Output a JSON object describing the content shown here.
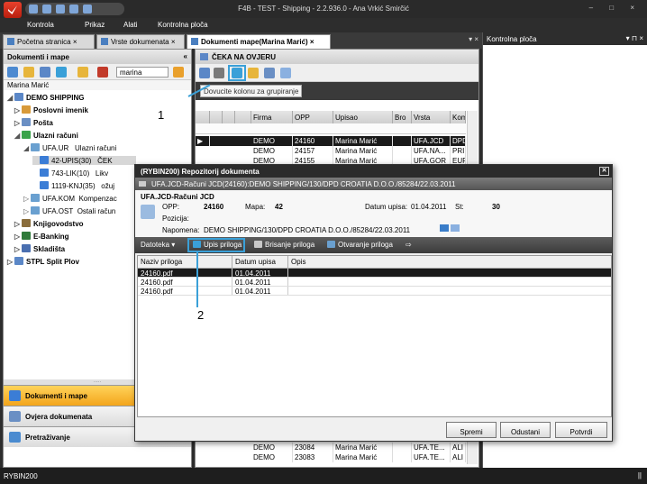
{
  "app": {
    "title": "F4B - TEST - Shipping - 2.2.936.0 - Ana  Vrkić Smirčić",
    "window_controls": "– □ ×"
  },
  "menu": [
    "Kontrola",
    "Prikaz",
    "Alati",
    "Kontrolna ploča"
  ],
  "tabs": [
    {
      "label": "Početna stranica",
      "active": false
    },
    {
      "label": "Vrste dokumenata",
      "active": false
    },
    {
      "label": "Dokumenti mape(Marina Marić)",
      "active": true
    }
  ],
  "tab_controls": "▾ ×",
  "right_panel": {
    "title": "Kontrolna ploča",
    "controls": "▾ ⊓ ×"
  },
  "left_panel": {
    "title": "Dokumenti i mape",
    "collapse": "«",
    "search_value": "marina",
    "user": "Marina Marić",
    "tree": [
      {
        "label": "DEMO SHIPPING",
        "bold": true
      },
      {
        "label": "Poslovni imenik",
        "bold": true
      },
      {
        "label": "Pošta",
        "bold": true
      },
      {
        "label": "Ulazni računi",
        "bold": true
      },
      {
        "label": "UFA.UR",
        "desc": "Ulazni računi"
      },
      {
        "label": "42-UPIS(30)",
        "desc": "ČEK"
      },
      {
        "label": "743-LIK(10)",
        "desc": "Likv"
      },
      {
        "label": "1119-KNJ(35)",
        "desc": "ožuj"
      },
      {
        "label": "UFA.KOM",
        "desc": "Kompenzac"
      },
      {
        "label": "UFA.OST",
        "desc": "Ostali račun"
      },
      {
        "label": "Knjigovodstvo",
        "bold": true
      },
      {
        "label": "E-Banking",
        "bold": true
      },
      {
        "label": "Skladišta",
        "bold": true
      },
      {
        "label": "STPL Split Plov",
        "bold": true
      }
    ],
    "nav": [
      {
        "label": "Dokumenti i mape",
        "active": true
      },
      {
        "label": "Ovjera dokumenata",
        "active": false
      },
      {
        "label": "Pretraživanje",
        "active": false
      }
    ]
  },
  "main": {
    "title": "ČEKA NA OVJERU",
    "group_hint": "Dovucite kolonu za grupiranje",
    "columns": [
      "Firma",
      "OPP",
      "Upisao",
      "Bro",
      "Vrsta",
      "Kom"
    ],
    "rows": [
      [
        "DEMO",
        "24160",
        "Marina Marić",
        "",
        "UFA.JCD",
        "DPD"
      ],
      [
        "DEMO",
        "24157",
        "Marina Marić",
        "",
        "UFA.NA...",
        "PRI"
      ],
      [
        "DEMO",
        "24155",
        "Marina Marić",
        "",
        "UFA.GOR",
        "EUR"
      ]
    ],
    "bottom_rows": [
      [
        "DEMO",
        "23084",
        "Marina Marić",
        "",
        "UFA.TE...",
        "ALI"
      ],
      [
        "DEMO",
        "23083",
        "Marina Marić",
        "",
        "UFA.TE...",
        "ALI"
      ]
    ]
  },
  "dialog": {
    "title": "(RYBIN200) Repozitorij dokumenta",
    "subtitle": "UFA.JCD-Računi JCD(24160):DEMO SHIPPING/130/DPD CROATIA D.O.O./85284/22.03.2011",
    "doc_name": "UFA.JCD-Računi JCD",
    "opp_label": "OPP:",
    "opp": "24160",
    "mapa_label": "Mapa:",
    "mapa": "42",
    "datum_label": "Datum upisa:",
    "datum": "01.04.2011",
    "st_label": "St:",
    "st": "30",
    "pozicija_label": "Pozicija:",
    "napomena_label": "Napomena:",
    "napomena": "DEMO SHIPPING/130/DPD CROATIA D.O.O./85284/22.03.2011",
    "toolbar": {
      "datoteka": "Datoteka ▾",
      "upis": "Upis priloga",
      "brisanje": "Brisanje priloga",
      "otvaranje": "Otvaranje priloga"
    },
    "columns": [
      "Naziv priloga",
      "Datum upisa",
      "Opis"
    ],
    "rows": [
      [
        "24160.pdf",
        "01.04.2011",
        ""
      ],
      [
        "24160.pdf",
        "01.04.2011",
        ""
      ],
      [
        "24160.pdf",
        "01.04.2011",
        ""
      ]
    ],
    "buttons": {
      "spremi": "Spremi",
      "odustani": "Odustani",
      "potvrdi": "Potvrdi"
    }
  },
  "callouts": {
    "one": "1",
    "two": "2"
  },
  "status": {
    "left": "RYBIN200",
    "right": "||"
  },
  "colors": {
    "accent": "#3aa0d8",
    "active_nav": "#f3a51c",
    "title_bar": "#2a2a2a"
  }
}
